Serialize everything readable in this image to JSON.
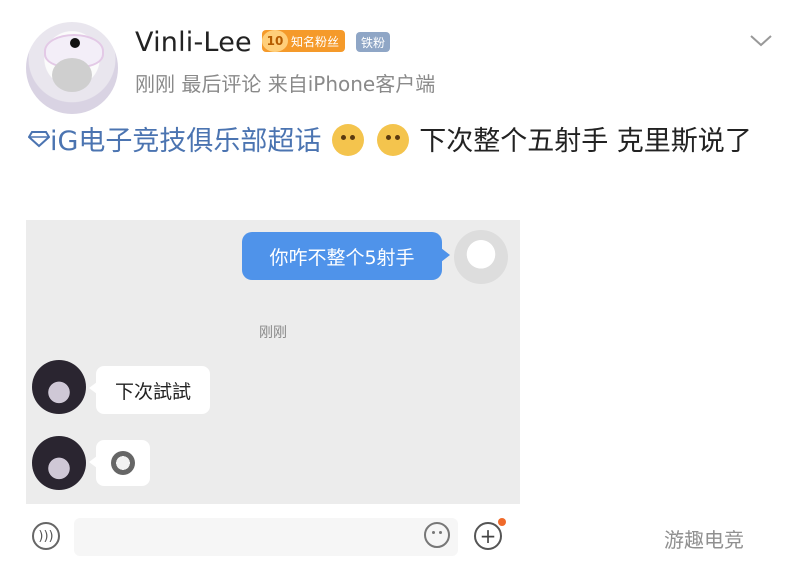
{
  "user": {
    "name": "Vinli-Lee",
    "fan_level": "10",
    "fan_badge": "知名粉丝",
    "iron_badge": "铁粉",
    "meta": "刚刚  最后评论  来自iPhone客户端"
  },
  "post": {
    "topic": "iG电子竞技俱乐部超话",
    "text": "下次整个五射手 克里斯说了"
  },
  "chat": {
    "outgoing": "你咋不整个5射手",
    "timestamp": "刚刚",
    "incoming": "下次試試"
  },
  "watermark": "游趣电竞",
  "colors": {
    "topic": "#4b74b1",
    "bubble_out": "#4f93ea",
    "fan_badge": "#f59a2a",
    "iron_badge": "#8fa6c6"
  }
}
